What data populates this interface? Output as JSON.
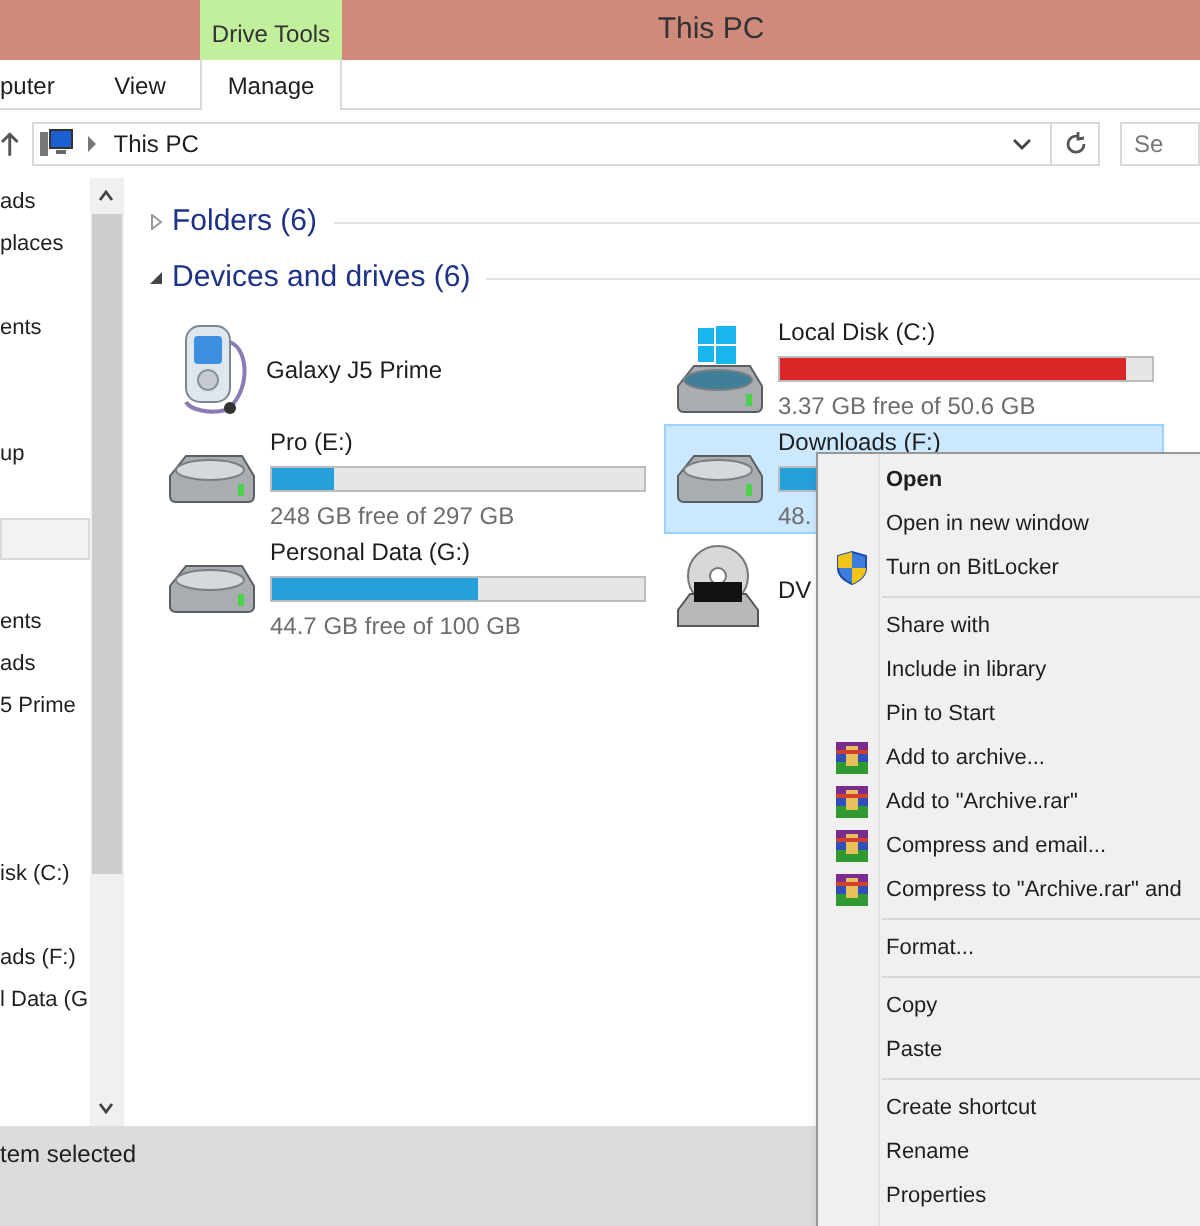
{
  "window": {
    "title": "This PC"
  },
  "context_tab": {
    "label": "Drive Tools"
  },
  "ribbon_tabs": [
    {
      "label": "puter",
      "selected": false
    },
    {
      "label": "View",
      "selected": false
    },
    {
      "label": "Manage",
      "selected": true
    }
  ],
  "address_bar": {
    "path": "This PC",
    "search_placeholder": "Se"
  },
  "sidebar": {
    "items": [
      {
        "label": "ads",
        "selected": false
      },
      {
        "label": "places",
        "selected": false
      },
      {
        "selected": false
      },
      {
        "label": "ents",
        "selected": false
      },
      {
        "selected": false
      },
      {
        "selected": false
      },
      {
        "label": "up",
        "selected": false
      },
      {
        "selected": false
      },
      {
        "selected": true
      },
      {
        "selected": false
      },
      {
        "label": "ents",
        "selected": false
      },
      {
        "label": "ads",
        "selected": false
      },
      {
        "label": "5 Prime",
        "selected": false
      },
      {
        "selected": false
      },
      {
        "selected": false
      },
      {
        "selected": false
      },
      {
        "label": "isk (C:)",
        "selected": false
      },
      {
        "selected": false
      },
      {
        "label": "ads (F:)",
        "selected": false
      },
      {
        "label": "l Data (G",
        "selected": false
      }
    ]
  },
  "groups": [
    {
      "title": "Folders (6)",
      "expanded": false
    },
    {
      "title": "Devices and drives (6)",
      "expanded": true
    }
  ],
  "drives": [
    {
      "kind": "phone",
      "name": "Galaxy J5 Prime",
      "selected": false
    },
    {
      "kind": "drive",
      "name": "Pro (E:)",
      "level": 0.165,
      "color": "#26a0da",
      "free": "248 GB free of 297 GB",
      "selected": false
    },
    {
      "kind": "drive",
      "name": "Personal Data (G:)",
      "level": 0.553,
      "color": "#26a0da",
      "free": "44.7 GB free of 100 GB",
      "selected": false
    },
    {
      "kind": "system_drive",
      "name": "Local Disk (C:)",
      "level": 0.93,
      "color": "#da2626",
      "free": "3.37 GB free of 50.6 GB",
      "selected": false
    },
    {
      "kind": "drive",
      "name": "Downloads (F:)",
      "level": 0.1,
      "color": "#26a0da",
      "free": "48.",
      "selected": true
    },
    {
      "kind": "dvd",
      "name": "DV",
      "selected": false
    }
  ],
  "context_menu": {
    "groups": [
      [
        {
          "kind": "plain",
          "label": "Open",
          "bold": true
        },
        {
          "kind": "plain",
          "label": "Open in new window",
          "bold": false
        },
        {
          "kind": "shield",
          "label": "Turn on BitLocker",
          "bold": false
        }
      ],
      [
        {
          "kind": "plain",
          "label": "Share with",
          "bold": false
        },
        {
          "kind": "plain",
          "label": "Include in library",
          "bold": false
        },
        {
          "kind": "plain",
          "label": "Pin to Start",
          "bold": false
        },
        {
          "kind": "archive",
          "label": "Add to archive...",
          "bold": false
        },
        {
          "kind": "archive",
          "label": "Add to \"Archive.rar\"",
          "bold": false
        },
        {
          "kind": "archive",
          "label": "Compress and email...",
          "bold": false
        },
        {
          "kind": "archive",
          "label": "Compress to \"Archive.rar\" and",
          "bold": false
        }
      ],
      [
        {
          "kind": "plain",
          "label": "Format...",
          "bold": false
        }
      ],
      [
        {
          "kind": "plain",
          "label": "Copy",
          "bold": false
        },
        {
          "kind": "plain",
          "label": "Paste",
          "bold": false
        }
      ],
      [
        {
          "kind": "plain",
          "label": "Create shortcut",
          "bold": false
        },
        {
          "kind": "plain",
          "label": "Rename",
          "bold": false
        },
        {
          "kind": "plain",
          "label": "Properties",
          "bold": false
        }
      ]
    ]
  },
  "status_bar": {
    "text": "tem selected"
  }
}
